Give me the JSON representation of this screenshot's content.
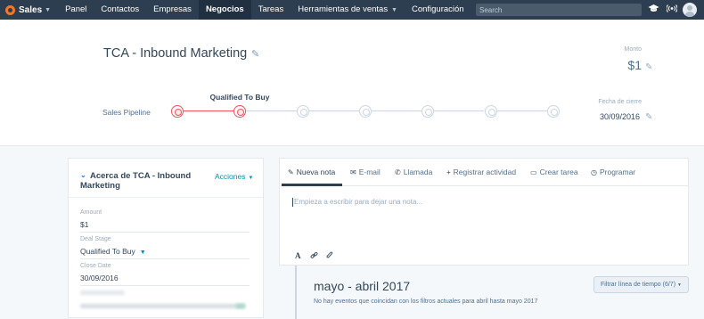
{
  "topnav": {
    "brand": "Sales",
    "items": [
      "Panel",
      "Contactos",
      "Empresas",
      "Negocios",
      "Tareas",
      "Herramientas de ventas",
      "Configuración"
    ],
    "active": "Negocios",
    "search_placeholder": "Search"
  },
  "deal": {
    "title": "TCA - Inbound Marketing",
    "amount_label": "Monto",
    "amount": "$1",
    "pipeline_label": "Sales Pipeline",
    "current_stage": "Qualified To Buy",
    "close_date_label": "Fecha de cierre",
    "close_date": "30/09/2016",
    "stages_total": 7,
    "stages_completed": 2
  },
  "about": {
    "title": "Acerca de TCA - Inbound Marketing",
    "actions": "Acciones",
    "fields": [
      {
        "label": "Amount",
        "value": "$1"
      },
      {
        "label": "Deal Stage",
        "value": "Qualified To Buy"
      },
      {
        "label": "Close Date",
        "value": "30/09/2016"
      }
    ]
  },
  "composer": {
    "tabs": [
      {
        "label": "Nueva nota",
        "icon": "note-icon"
      },
      {
        "label": "E-mail",
        "icon": "email-icon"
      },
      {
        "label": "Llamada",
        "icon": "phone-icon"
      },
      {
        "label": "Registrar actividad",
        "icon": "plus-icon"
      },
      {
        "label": "Crear tarea",
        "icon": "calendar-icon"
      },
      {
        "label": "Programar",
        "icon": "clock-icon"
      }
    ],
    "placeholder": "Empieza a escribir para dejar una nota..."
  },
  "timeline": {
    "month": "mayo - abril 2017",
    "empty_message": "No hay eventos que coincidan con los filtros actuales para abril hasta mayo 2017",
    "filter_button": "Filtrar línea de tiempo (6/7)"
  },
  "colors": {
    "nav_bg": "#2d3e50",
    "accent": "#0091ae",
    "stage_done": "#f2545b",
    "brand": "#f57722"
  }
}
